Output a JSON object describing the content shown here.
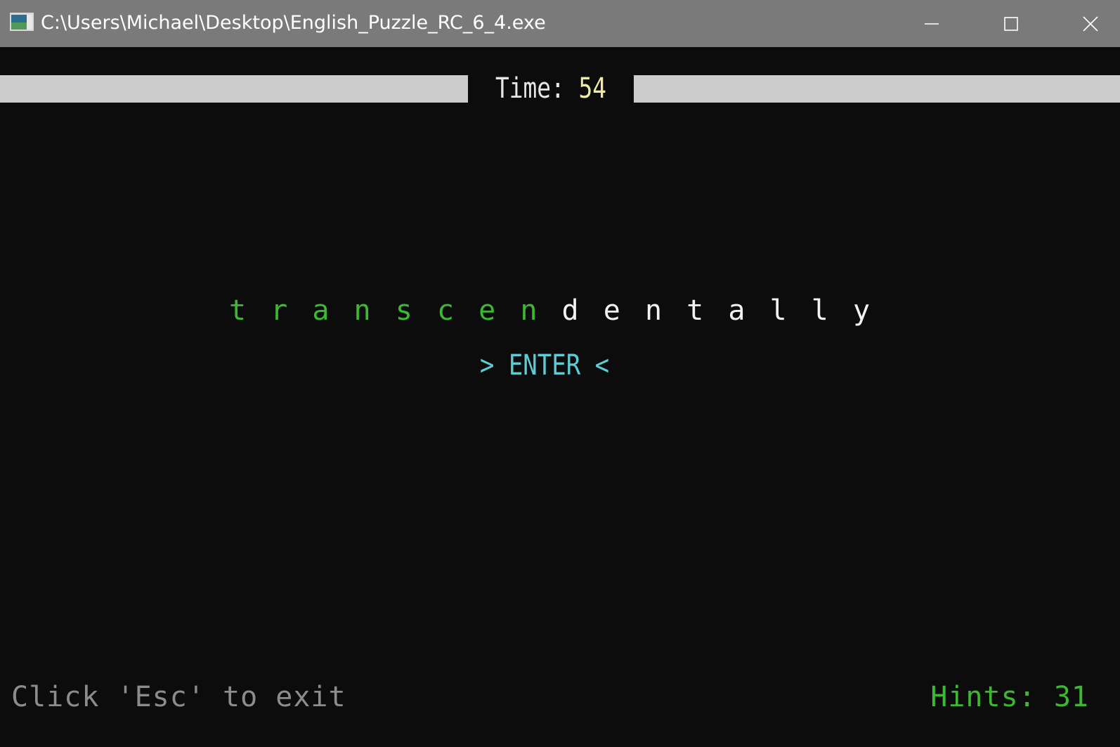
{
  "window": {
    "title": "C:\\Users\\Michael\\Desktop\\English_Puzzle_RC_6_4.exe",
    "icon": "console-app-icon",
    "controls": [
      "minimize-icon",
      "maximize-icon",
      "close-icon"
    ]
  },
  "timer": {
    "label": "Time:",
    "value": "54"
  },
  "word": {
    "text": "transcendentally",
    "letters": [
      "t",
      "r",
      "a",
      "n",
      "s",
      "c",
      "e",
      "n",
      "d",
      "e",
      "n",
      "t",
      "a",
      "l",
      "l",
      "y"
    ],
    "typed_count": 8
  },
  "enter": {
    "left_marker": ">",
    "label": "ENTER",
    "right_marker": "<"
  },
  "footer": {
    "exit_hint": "Click 'Esc' to exit",
    "hints_label": "Hints:",
    "hints_value": "31"
  },
  "colors": {
    "background": "#0c0c0c",
    "titlebar": "#7a7a7a",
    "time_bar": "#cccccc",
    "typed_letter": "#3cb832",
    "untyped_letter": "#f2f2f2",
    "time_value": "#f2e9a4",
    "enter": "#5fcbd4",
    "exit_hint": "#8c8c8c",
    "hints": "#3cb832"
  }
}
